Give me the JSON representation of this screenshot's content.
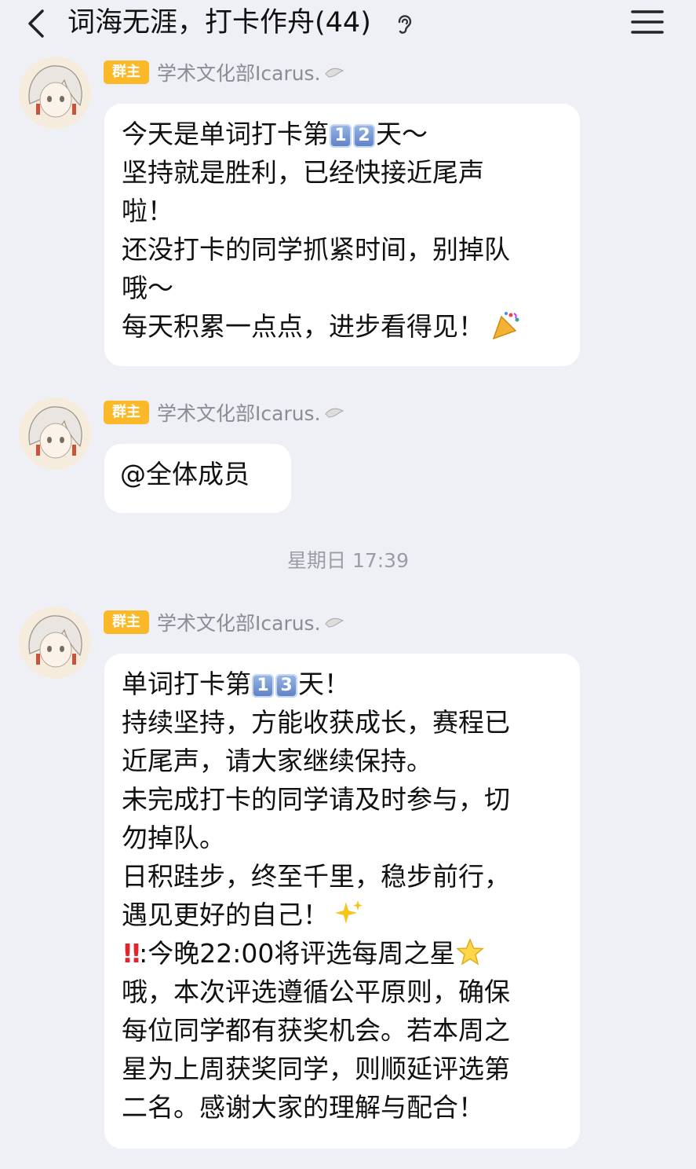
{
  "header": {
    "title": "词海无涯，打卡作舟(44)",
    "back_icon": "chevron-left-icon",
    "ear_icon": "earpiece-icon",
    "menu_icon": "hamburger-menu-icon"
  },
  "messages": [
    {
      "badge": "群主",
      "sender": "学术文化部Icarus.",
      "lines": {
        "l1a": "今天是单词打卡第",
        "k1": "1",
        "k2": "2",
        "l1b": "天～",
        "l2": "坚持就是胜利，已经快接近尾声",
        "l3": "啦！",
        "l4": "还没打卡的同学抓紧时间，别掉队",
        "l5": "哦～",
        "l6": "每天积累一点点，进步看得见！"
      },
      "emoji": "party-popper-icon"
    },
    {
      "badge": "群主",
      "sender": "学术文化部Icarus.",
      "text": "@全体成员"
    },
    {
      "badge": "群主",
      "sender": "学术文化部Icarus.",
      "lines": {
        "l1a": "单词打卡第",
        "k1": "1",
        "k2": "3",
        "l1b": "天！",
        "l2": "持续坚持，方能收获成长，赛程已",
        "l3": "近尾声，请大家继续保持。",
        "l4": "未完成打卡的同学请及时参与，切",
        "l5": "勿掉队。",
        "l6": "日积跬步，终至千里，稳步前行，",
        "l7": "遇见更好的自己！",
        "l8a": "!!",
        "l8b": ":今晚22:00将评选每周之星",
        "l9": "哦，本次评选遵循公平原则，确保",
        "l10": "每位同学都有获奖机会。若本周之",
        "l11": "星为上周获奖同学，则顺延评选第",
        "l12": "二名。感谢大家的理解与配合！"
      }
    }
  ],
  "timestamp": "星期日 17:39",
  "colors": {
    "badge": "#fbb929",
    "background": "#eff0f5",
    "bubble": "#ffffff",
    "name": "#8a8d93"
  }
}
